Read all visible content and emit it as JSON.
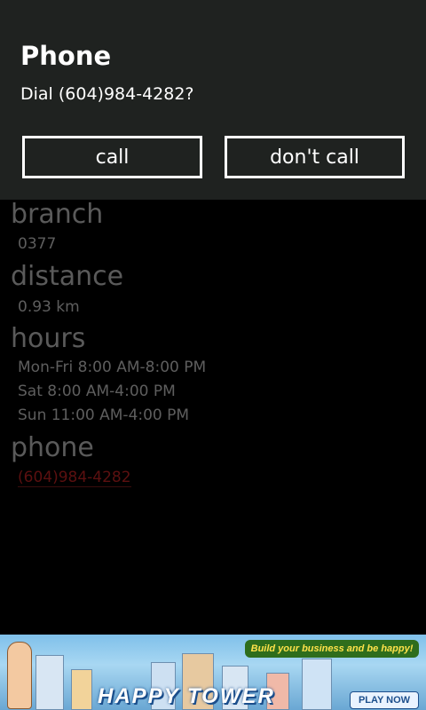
{
  "dialog": {
    "title": "Phone",
    "message": "Dial (604)984-4282?",
    "call_label": "call",
    "dont_call_label": "don't call"
  },
  "details": {
    "branch_label": "branch",
    "branch_value": "0377",
    "distance_label": "distance",
    "distance_value": "0.93 km",
    "hours_label": "hours",
    "hours": [
      "Mon-Fri 8:00 AM-8:00 PM",
      "Sat 8:00 AM-4:00 PM",
      "Sun 11:00 AM-4:00 PM"
    ],
    "phone_label": "phone",
    "phone_value": "(604)984-4282"
  },
  "ad": {
    "tagline": "Build your business and be happy!",
    "title": "HAPPY TOWER",
    "play_label": "PLAY NOW"
  },
  "colors": {
    "dialog_bg": "#1f2220",
    "dimmed_text": "#5a5a5a",
    "dimmed_link": "#5c1010"
  }
}
